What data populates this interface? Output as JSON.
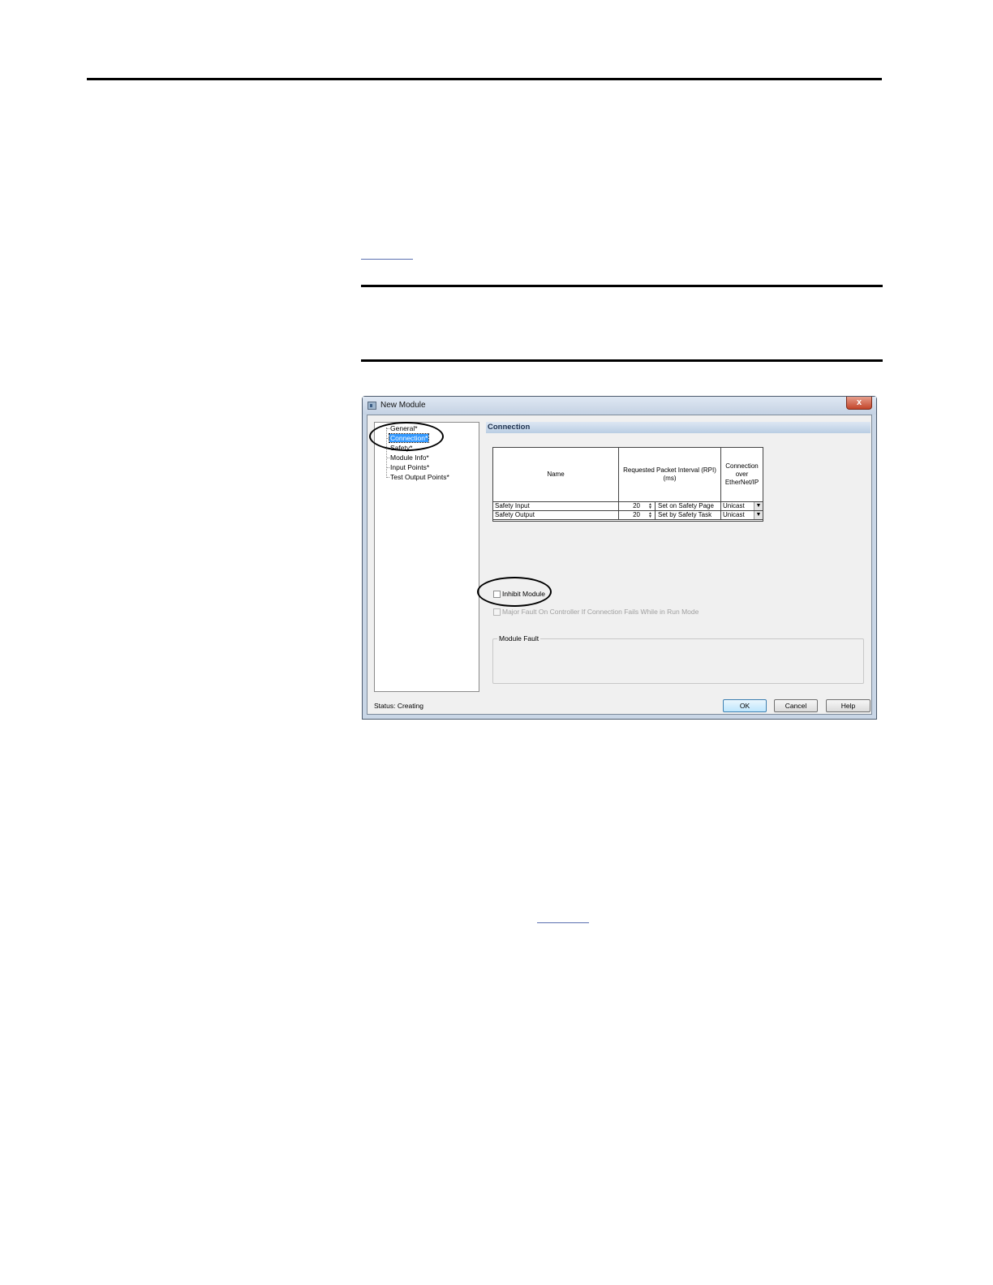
{
  "dialog": {
    "title": "New Module",
    "close_glyph": "x",
    "nav": {
      "items": [
        "General*",
        "Connection*",
        "Safety*",
        "Module Info*",
        "Input Points*",
        "Test Output Points*"
      ],
      "selected_index": 1
    },
    "section_title": "Connection",
    "table": {
      "headers": [
        "Name",
        "Requested Packet Interval (RPI) (ms)",
        "Connection over EtherNet/IP"
      ],
      "rows": [
        {
          "name": "Safety Input",
          "rpi": "20",
          "note": "Set on Safety Page",
          "connection": "Unicast"
        },
        {
          "name": "Safety Output",
          "rpi": "20",
          "note": "Set by Safety Task",
          "connection": "Unicast"
        }
      ]
    },
    "inhibit_module": {
      "label": "Inhibit Module",
      "checked": false
    },
    "major_fault": {
      "label": "Major Fault On Controller If Connection Fails While in Run Mode",
      "checked": false,
      "enabled": false
    },
    "module_fault_label": "Module Fault",
    "status": "Status:  Creating",
    "buttons": {
      "ok": "OK",
      "cancel": "Cancel",
      "help": "Help"
    }
  }
}
